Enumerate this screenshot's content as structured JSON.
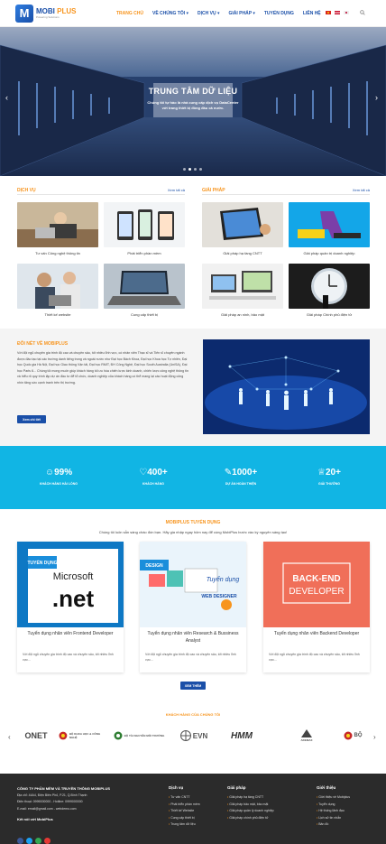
{
  "header": {
    "logo_main": "MOBI",
    "logo_accent": "PLUS",
    "logo_tagline": "Powering Solutions",
    "nav": [
      {
        "label": "TRANG CHỦ",
        "active": true
      },
      {
        "label": "VỀ CHÚNG TÔI ▾",
        "active": false
      },
      {
        "label": "DỊCH VỤ ▾",
        "active": false
      },
      {
        "label": "GIẢI PHÁP ▾",
        "active": false
      },
      {
        "label": "TUYỂN DỤNG",
        "active": false
      },
      {
        "label": "LIÊN HỆ",
        "active": false
      }
    ]
  },
  "hero": {
    "title": "TRUNG TÂM DỮ LIỆU",
    "subtitle_1": "Chúng tôi tự hào là nhà cung cấp dịch vụ DataCenter",
    "subtitle_2": "với trang thiết bị đồng đầu cả nước.",
    "slide_count": 4,
    "active_slide": 1
  },
  "services": {
    "title": "DỊCH VỤ",
    "more": "Xem tất cả",
    "items": [
      "Tư vấn Công nghệ thông tin",
      "Phát triển phần mềm",
      "Thiết kế website",
      "Cung cấp thiết bị"
    ]
  },
  "solutions": {
    "title": "GIẢI PHÁP",
    "more": "Xem tất cả",
    "items": [
      "Giải pháp hạ tầng CNTT",
      "Giải pháp quản trị doanh nghiệp",
      "Giải pháp an ninh, bảo mật",
      "Giải pháp Chính phủ điện tử"
    ]
  },
  "about": {
    "title": "ĐÔI NÉT VỀ MOBIPLUS",
    "text": "Với đội ngũ chuyên gia trình độ cao và chuyên sâu, tốt nhiều lĩnh vực, có nhân viên Thạc sĩ và Tiến sĩ chuyên ngành được đào tạo tại các trường danh tiếng trong và ngoài nước như Đại học Bách Khoa, Đại học Khoa học Tự nhiên, Đại học Quốc gia Hà Nội, Đại học Giao thông Vận tải, Đại học RMIT, ĐH Công Nghệ, Đại học South Australia (UniSA), Đại học Paris 6... Chúng tôi mong muốn giúp khách hàng tối ưu hóa chiến lược kinh doanh, chiến lược công nghệ thông tin và hiểu rõ quy trình lập dự án đầu tư để tổ chức, doanh nghiệp của khách hàng có thể mang lại các hoạt động công nhìn tăng sức cạnh tranh trên thị trường.",
    "button": "Xem chi tiết"
  },
  "stats": [
    {
      "value": "99%",
      "label": "KHÁCH HÀNG HÀI LÒNG",
      "icon": "smile-icon"
    },
    {
      "value": "400+",
      "label": "KHÁCH HÀNG",
      "icon": "heart-icon"
    },
    {
      "value": "1000+",
      "label": "DỰ ÁN HOÀN THIỆN",
      "icon": "pencil-icon"
    },
    {
      "value": "20+",
      "label": "GIẢI THƯỞNG",
      "icon": "trophy-icon"
    }
  ],
  "recruit": {
    "title": "MOBIPLUS TUYỂN DỤNG",
    "subtitle": "Chúng tôi luôn sẵn sàng chào đón bạn. Hãy gia nhập ngay hôm nay để cùng MobiPlus bước vào kỷ nguyên sáng tạo!",
    "cards": [
      {
        "title": "Tuyển dụng nhân viên Frontend Developer",
        "text": "Với đội ngũ chuyên gia trình độ cao và chuyên sâu, tốt nhiều lĩnh vực...",
        "img_tag": "TUYỂN DỤNG",
        "img_text": ".net",
        "img_brand": "Microsoft"
      },
      {
        "title": "Tuyển dụng nhân viên Research & Bussiness Analyst",
        "text": "Với đội ngũ chuyên gia trình độ cao và chuyên sâu, tốt nhiều lĩnh vực...",
        "img_tag": "Tuyển dụng",
        "img_text": "WEB DESIGNER",
        "img_brand": "DESIGN"
      },
      {
        "title": "Tuyển dụng nhân viên Backend Developer",
        "text": "Với đội ngũ chuyên gia trình độ cao và chuyên sâu, tốt nhiều lĩnh vực...",
        "img_tag": "BACK-END",
        "img_text": "DEVELOPER",
        "img_brand": ""
      }
    ],
    "button": "XEM THÊM"
  },
  "partners": {
    "title": "KHÁCH HÀNG CỦA CHÚNG TÔI",
    "items": [
      "ONET",
      "BỘ KHOA HỌC & CÔNG NGHỆ",
      "BỘ TÀI NGUYÊN MÔI TRƯỜNG",
      "EVN",
      "HMM",
      "ADEMAX",
      "BỘ"
    ]
  },
  "footer": {
    "company": "CÔNG TY PHẦN MỀM VÀ TRUYỀN THÔNG MOBIPLUS",
    "address": "Địa chỉ: 44A4, Điện Biên Phủ, P.21, Q.Bình Thạnh",
    "phone": "Điện thoại: 0999000000 - Hotline: 0999000000",
    "email": "E-mail: email@gmail.com - webdemo.com",
    "connect": "Kết nối với MobiPlus",
    "col_services_title": "Dịch vụ",
    "col_services": [
      "Tư vấn CNTT",
      "Phát triển phần mềm",
      "Thiết kế Website",
      "Cung cấp thiết bị",
      "Trung tâm dữ liệu"
    ],
    "col_solutions_title": "Giải pháp",
    "col_solutions": [
      "Giải pháp hạ tầng CNTT",
      "Giải pháp bảo mật, bảo mật",
      "Giải pháp quản lý doanh nghiệp",
      "Giải pháp chính phủ điện tử"
    ],
    "col_intro_title": "Giới thiệu",
    "col_intro": [
      "Giới thiệu về Mobiplus",
      "Tuyển dụng",
      "Hệ thống lãnh đạo",
      "Lịch sử tin nhắn",
      "Bản đồ"
    ]
  },
  "colors": {
    "brand": "#1a4fa8",
    "accent": "#f7941d",
    "stats_bg": "#11b5e4",
    "footer_bg": "#2b2b2b"
  }
}
